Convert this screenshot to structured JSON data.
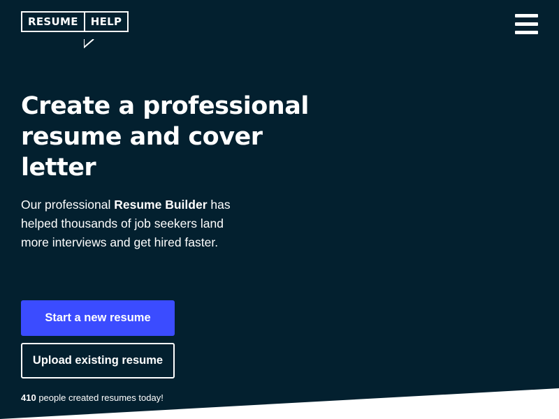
{
  "header": {
    "logo": {
      "left_text": "RESUME",
      "right_text": "HELP"
    },
    "menu_icon": "hamburger-menu-icon"
  },
  "hero": {
    "title": "Create a professional resume and cover letter",
    "description_before": "Our professional ",
    "description_bold": "Resume Builder",
    "description_after": " has helped thousands of job seekers land more interviews and get hired faster.",
    "primary_button_label": "Start a new resume",
    "secondary_button_label": "Upload existing resume",
    "counter_value": "410",
    "counter_text": " people created resumes today!"
  },
  "colors": {
    "background": "#03202f",
    "primary_button": "#3b4cff",
    "text": "#ffffff",
    "diagonal_fill": "#ffffff"
  }
}
